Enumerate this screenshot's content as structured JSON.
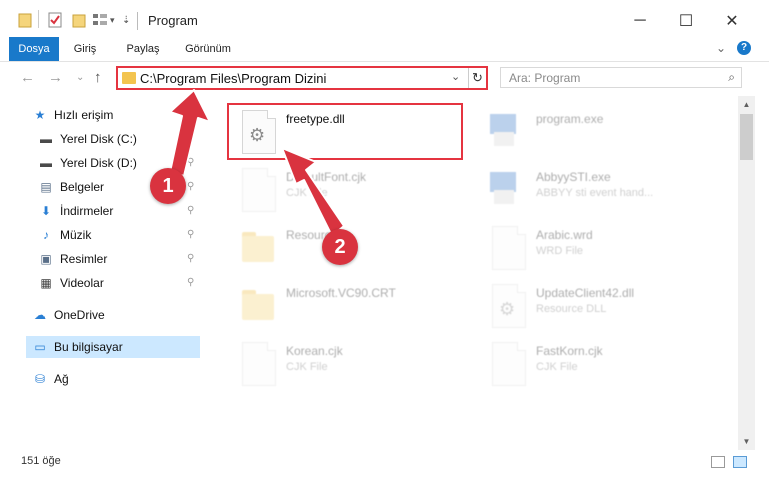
{
  "window": {
    "title": "Program",
    "minimize": "─",
    "maximize": "☐",
    "close": "✕"
  },
  "ribbon": {
    "tabs": [
      "Dosya",
      "Giriş",
      "Paylaş",
      "Görünüm"
    ],
    "expand": "⌄",
    "help": "?"
  },
  "address": {
    "path": "C:\\Program Files\\Program Dizini",
    "dropdown": "⌄",
    "refresh": "↻"
  },
  "search": {
    "placeholder": "Ara: Program",
    "icon": "⌕"
  },
  "nav": {
    "back": "←",
    "forward": "→",
    "recent": "⌄",
    "up": "↑"
  },
  "sidebar": {
    "items": [
      {
        "label": "Hızlı erişim",
        "icon": "star-icon",
        "glyph": "★",
        "color": "#2a7fd4",
        "pinned": false
      },
      {
        "label": "Yerel Disk (C:)",
        "icon": "drive-icon",
        "glyph": "▬",
        "color": "#4a4a4a",
        "pinned": true
      },
      {
        "label": "Yerel Disk (D:)",
        "icon": "drive-icon",
        "glyph": "▬",
        "color": "#4a4a4a",
        "pinned": true
      },
      {
        "label": "Belgeler",
        "icon": "documents-icon",
        "glyph": "▤",
        "color": "#5a6f89",
        "pinned": true
      },
      {
        "label": "İndirmeler",
        "icon": "download-icon",
        "glyph": "⬇",
        "color": "#2a7fd4",
        "pinned": true
      },
      {
        "label": "Müzik",
        "icon": "music-icon",
        "glyph": "♪",
        "color": "#2a7fd4",
        "pinned": true
      },
      {
        "label": "Resimler",
        "icon": "pictures-icon",
        "glyph": "▣",
        "color": "#5a6f89",
        "pinned": true
      },
      {
        "label": "Videolar",
        "icon": "videos-icon",
        "glyph": "▦",
        "color": "#3d3d3d",
        "pinned": true
      },
      {
        "label": "OneDrive",
        "icon": "cloud-icon",
        "glyph": "☁",
        "color": "#2a7fd4",
        "pinned": false
      },
      {
        "label": "Bu bilgisayar",
        "icon": "computer-icon",
        "glyph": "▭",
        "color": "#2a7fd4",
        "pinned": false,
        "selected": true
      },
      {
        "label": "Ağ",
        "icon": "network-icon",
        "glyph": "⛁",
        "color": "#2a7fd4",
        "pinned": false
      }
    ],
    "pin_glyph": "📌"
  },
  "files": [
    {
      "name": "freetype.dll",
      "type": "",
      "kind": "dll"
    },
    {
      "name": "program.exe",
      "type": "",
      "kind": "exe"
    },
    {
      "name": "DefaultFont.cjk",
      "type": "CJK File",
      "kind": "file"
    },
    {
      "name": "AbbyySTI.exe",
      "type": "ABBYY sti event hand...",
      "kind": "exe"
    },
    {
      "name": "Resources",
      "type": "",
      "kind": "folder"
    },
    {
      "name": "Arabic.wrd",
      "type": "WRD File",
      "kind": "file"
    },
    {
      "name": "Microsoft.VC90.CRT",
      "type": "",
      "kind": "folder"
    },
    {
      "name": "UpdateClient42.dll",
      "type": "Resource DLL",
      "kind": "dll"
    },
    {
      "name": "Korean.cjk",
      "type": "CJK File",
      "kind": "file"
    },
    {
      "name": "FastKorn.cjk",
      "type": "CJK File",
      "kind": "file"
    }
  ],
  "status": {
    "count": "151 öğe"
  },
  "callouts": [
    "1",
    "2"
  ],
  "colors": {
    "accent": "#1979ca",
    "highlight": "#e53440",
    "callout": "#d9333f"
  }
}
